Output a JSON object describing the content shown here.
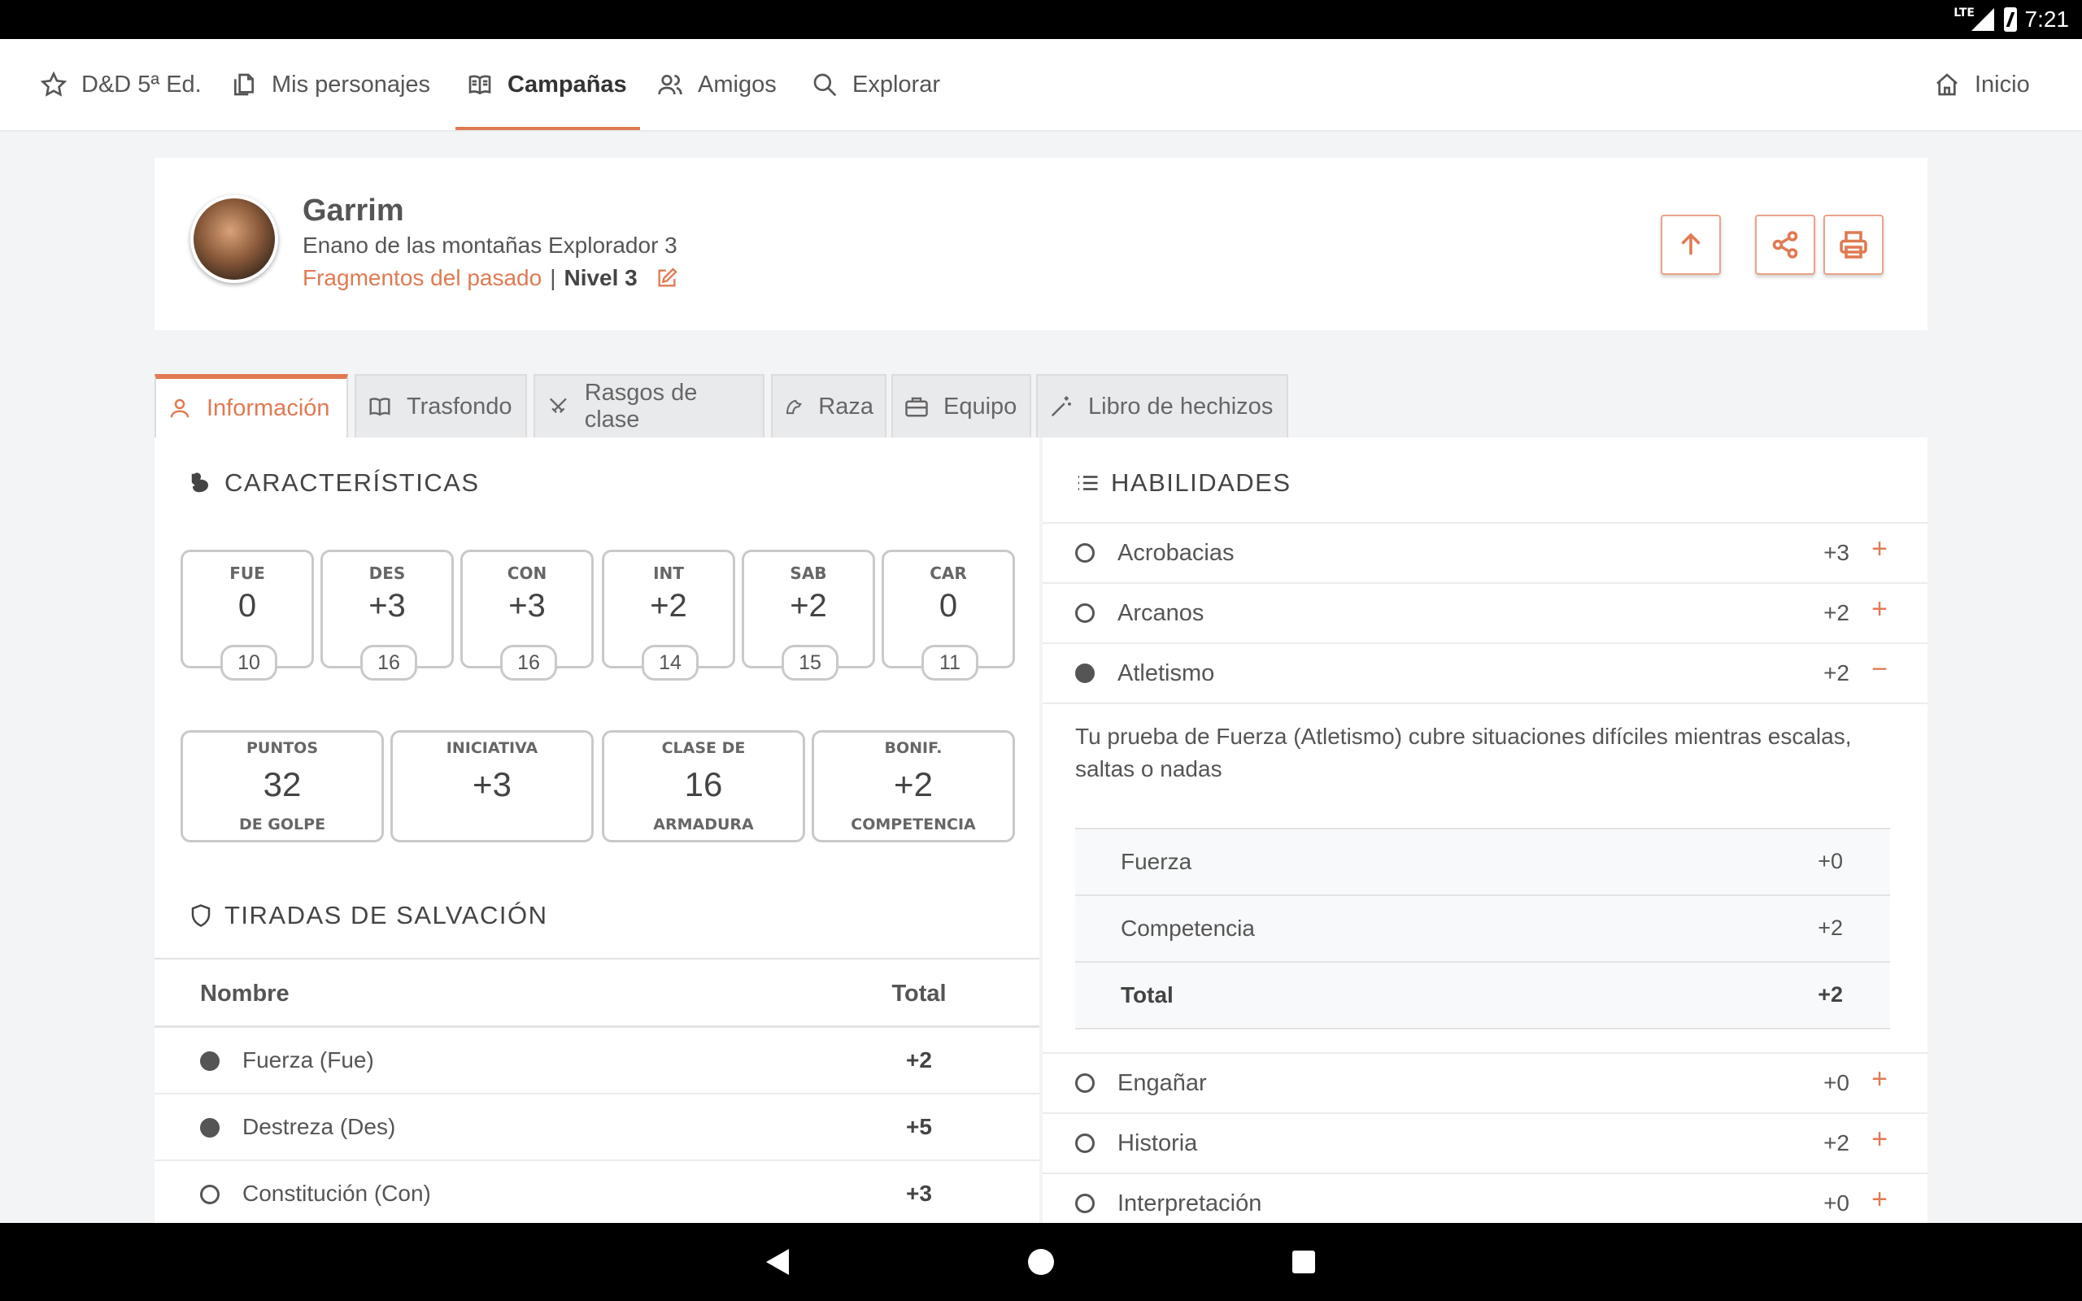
{
  "status_bar": {
    "network": "LTE",
    "time": "7:21"
  },
  "nav": {
    "items": [
      {
        "label": "D&D 5ª Ed.",
        "icon": "star-icon"
      },
      {
        "label": "Mis personajes",
        "icon": "documents-icon"
      },
      {
        "label": "Campañas",
        "icon": "book-icon",
        "active": true
      },
      {
        "label": "Amigos",
        "icon": "users-icon"
      },
      {
        "label": "Explorar",
        "icon": "search-icon"
      }
    ],
    "home_label": "Inicio"
  },
  "character": {
    "name": "Garrim",
    "description": "Enano de las montañas Explorador 3",
    "campaign": "Fragmentos del pasado",
    "separator": "|",
    "level": "Nivel 3"
  },
  "tabs": [
    {
      "label": "Información",
      "icon": "user-icon",
      "active": true
    },
    {
      "label": "Trasfondo",
      "icon": "book-icon"
    },
    {
      "label": "Rasgos de clase",
      "icon": "swords-icon"
    },
    {
      "label": "Raza",
      "icon": "dragon-icon"
    },
    {
      "label": "Equipo",
      "icon": "briefcase-icon"
    },
    {
      "label": "Libro de hechizos",
      "icon": "wand-icon"
    }
  ],
  "characteristics": {
    "title": "CARACTERÍSTICAS",
    "abilities": [
      {
        "label": "FUE",
        "mod": "0",
        "score": "10"
      },
      {
        "label": "DES",
        "mod": "+3",
        "score": "16"
      },
      {
        "label": "CON",
        "mod": "+3",
        "score": "16"
      },
      {
        "label": "INT",
        "mod": "+2",
        "score": "14"
      },
      {
        "label": "SAB",
        "mod": "+2",
        "score": "15"
      },
      {
        "label": "CAR",
        "mod": "0",
        "score": "11"
      }
    ],
    "stats": [
      {
        "label": "PUNTOS",
        "value": "32",
        "label2": "DE GOLPE"
      },
      {
        "label": "INICIATIVA",
        "value": "+3",
        "label2": ""
      },
      {
        "label": "CLASE DE",
        "value": "16",
        "label2": "ARMADURA"
      },
      {
        "label": "BONIF.",
        "value": "+2",
        "label2": "COMPETENCIA"
      }
    ]
  },
  "saving_throws": {
    "title": "TIRADAS DE SALVACIÓN",
    "col_name": "Nombre",
    "col_total": "Total",
    "rows": [
      {
        "name": "Fuerza (Fue)",
        "total": "+2",
        "proficient": true
      },
      {
        "name": "Destreza (Des)",
        "total": "+5",
        "proficient": true
      },
      {
        "name": "Constitución (Con)",
        "total": "+3",
        "proficient": false
      }
    ]
  },
  "skills": {
    "title": "HABILIDADES",
    "rows": [
      {
        "name": "Acrobacias",
        "bonus": "+3",
        "toggle": "+",
        "proficient": false
      },
      {
        "name": "Arcanos",
        "bonus": "+2",
        "toggle": "+",
        "proficient": false
      },
      {
        "name": "Atletismo",
        "bonus": "+2",
        "toggle": "−",
        "proficient": true
      }
    ],
    "expanded": {
      "description": "Tu prueba de Fuerza (Atletismo) cubre situaciones difíciles mientras escalas, saltas o nadas",
      "breakdown": [
        {
          "key": "Fuerza",
          "value": "+0"
        },
        {
          "key": "Competencia",
          "value": "+2"
        },
        {
          "key": "Total",
          "value": "+2",
          "total": true
        }
      ]
    },
    "rows_after": [
      {
        "name": "Engañar",
        "bonus": "+0",
        "toggle": "+",
        "proficient": false
      },
      {
        "name": "Historia",
        "bonus": "+2",
        "toggle": "+",
        "proficient": false
      },
      {
        "name": "Interpretación",
        "bonus": "+0",
        "toggle": "+",
        "proficient": false
      }
    ]
  },
  "colors": {
    "accent": "#e07a52",
    "text": "#4a4a4a",
    "background": "#f3f4f6"
  }
}
